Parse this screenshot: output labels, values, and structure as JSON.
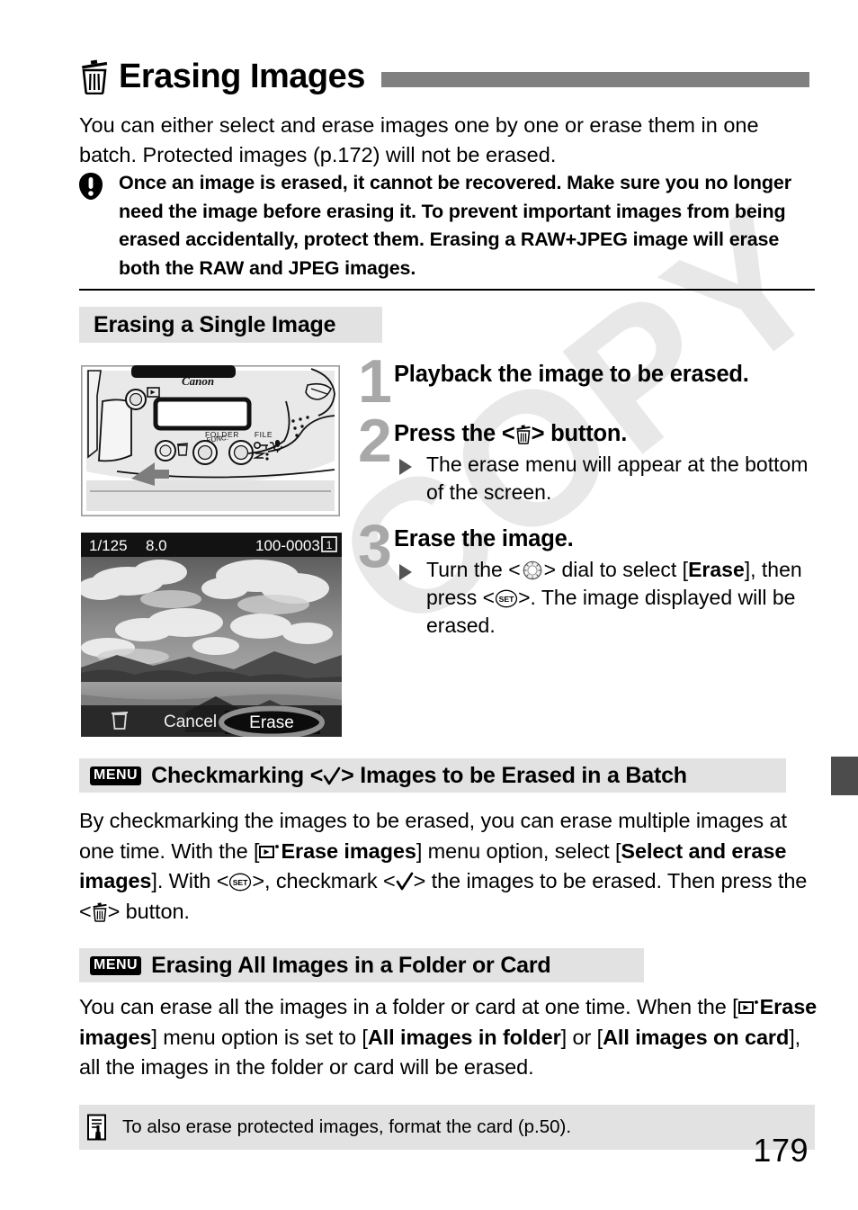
{
  "page": {
    "number": "179",
    "watermark": "COPY"
  },
  "title": {
    "icon": "trash-icon",
    "text": "Erasing Images"
  },
  "intro": {
    "text": "You can either select and erase images one by one or erase them in one batch. Protected images (p.172) will not be erased."
  },
  "caution": {
    "icon": "caution-icon",
    "text": "Once an image is erased, it cannot be recovered. Make sure you no longer need the image before erasing it. To prevent important images from being erased accidentally, protect them. Erasing a RAW+JPEG image will erase both the RAW and JPEG images."
  },
  "sections": {
    "single": {
      "heading": "Erasing a Single Image"
    },
    "checkmark": {
      "badge": "MENU",
      "heading_before": "Checkmarking <",
      "heading_icon": "checkmark-icon",
      "heading_after": "> Images to be Erased in a Batch",
      "paragraph_1": "By checkmarking the images to be erased, you can erase multiple images at one time. With the [",
      "menu_option_1": "Erase images",
      "paragraph_2": "] menu option, select [",
      "menu_option_2": "Select and erase images",
      "paragraph_3": "]. With <",
      "paragraph_4": ">, checkmark <",
      "paragraph_5": "> the images to be erased. Then press the <",
      "paragraph_6": "> button."
    },
    "all_images": {
      "badge": "MENU",
      "heading": "Erasing All Images in a Folder or Card",
      "paragraph_1": "You can erase all the images in a folder or card at one time. When the [",
      "menu_option_1": "Erase images",
      "paragraph_2": "] menu option is set to [",
      "menu_option_2": "All images in folder",
      "paragraph_3": "] or [",
      "menu_option_3": "All images on card",
      "paragraph_4": "], all the images in the folder or card will be erased."
    }
  },
  "steps": [
    {
      "number": "1",
      "title": "Playback the image to be erased.",
      "sub": ""
    },
    {
      "number": "2",
      "title_before": "Press the <",
      "title_icon": "trash-icon",
      "title_after": "> button.",
      "sub": "The erase menu will appear at the bottom of the screen."
    },
    {
      "number": "3",
      "title": "Erase the image.",
      "sub_1": "Turn the <",
      "sub_icon_1": "dial-icon",
      "sub_2": "> dial to select [",
      "sub_bold": "Erase",
      "sub_3": "], then press <",
      "sub_icon_2": "set-icon",
      "sub_4": ">. The image displayed will be erased."
    }
  ],
  "camera_figure": {
    "brand": "Canon",
    "label_folder": "FOLDER",
    "label_file": "FILE",
    "label_func": "FUNC."
  },
  "lcd_figure": {
    "shutter_speed": "1/125",
    "aperture": "8.0",
    "file_number": "100-0003",
    "card_badge": "1",
    "menu_cancel": "Cancel",
    "menu_erase": "Erase"
  },
  "note": {
    "icon": "note-icon",
    "text": "To also erase protected images, format the card (p.50)."
  },
  "colors": {
    "section_bar": "#e2e2e2",
    "title_rule": "#808080",
    "step_number": "#a8a8a8",
    "edge_tab": "#4c4c4c"
  }
}
